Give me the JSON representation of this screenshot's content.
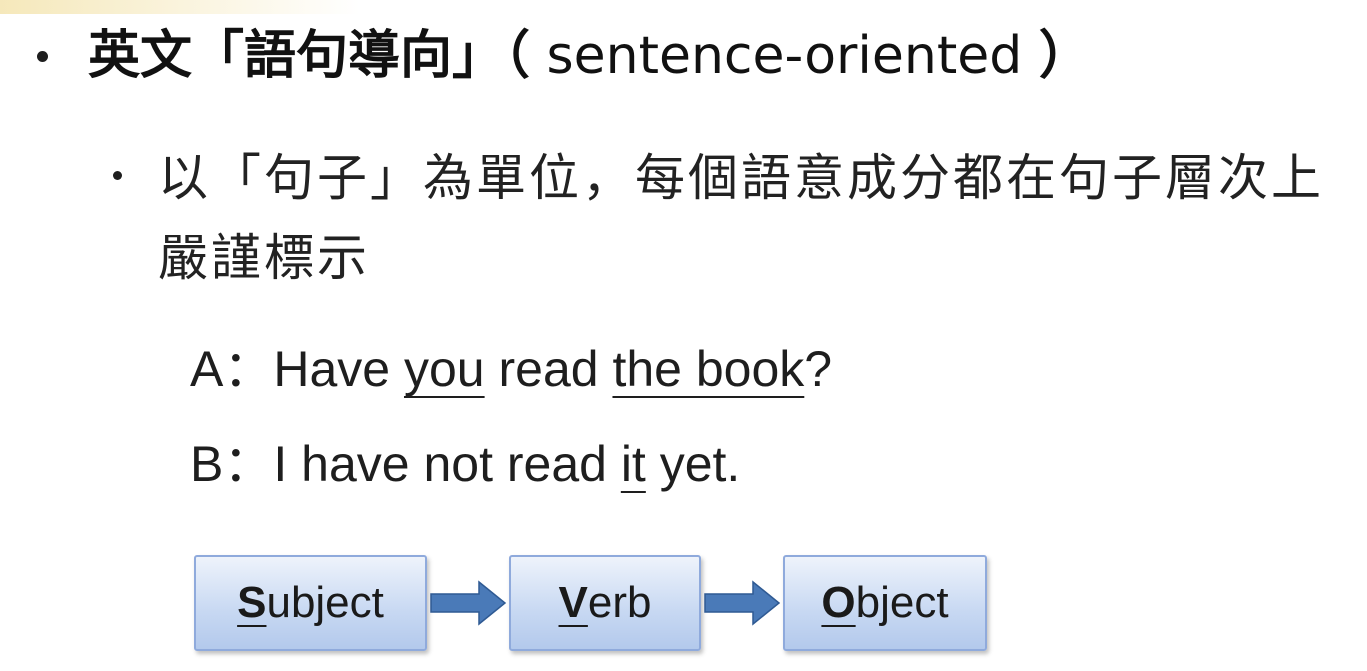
{
  "heading": {
    "cjk": "英文「語句導向」（",
    "latin": " sentence-oriented ",
    "close": "）"
  },
  "subpoint": {
    "text": "以「句子」為單位，每個語意成分都在句子層次上嚴謹標示"
  },
  "examples": {
    "a": {
      "speaker": "A：",
      "w1": "Have ",
      "u1": "you",
      "w2": " read ",
      "u2": "the book",
      "w3": "?"
    },
    "b": {
      "speaker": "B：",
      "w1": "I have not read ",
      "u1": "it",
      "w2": " yet."
    }
  },
  "flow": {
    "subject": {
      "initial": "S",
      "rest": "ubject"
    },
    "verb": {
      "initial": "V",
      "rest": "erb"
    },
    "object": {
      "initial": "O",
      "rest": "bject"
    },
    "arrow_color": "#4a7ab8"
  }
}
